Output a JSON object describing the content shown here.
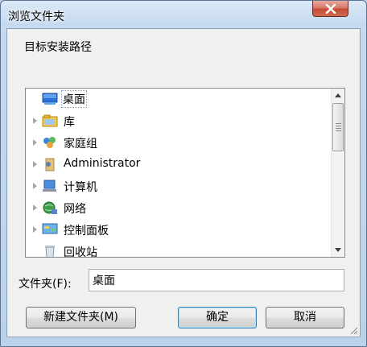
{
  "window": {
    "title": "浏览文件夹",
    "close_icon": "close-icon"
  },
  "instruction": "目标安装路径",
  "tree": {
    "items": [
      {
        "label": "桌面",
        "icon": "desktop-icon",
        "selected": true
      },
      {
        "label": "库",
        "icon": "libraries-icon"
      },
      {
        "label": "家庭组",
        "icon": "homegroup-icon"
      },
      {
        "label": "Administrator",
        "icon": "user-folder-icon"
      },
      {
        "label": "计算机",
        "icon": "computer-icon"
      },
      {
        "label": "网络",
        "icon": "network-icon"
      },
      {
        "label": "控制面板",
        "icon": "control-panel-icon"
      },
      {
        "label": "回收站",
        "icon": "recycle-bin-icon"
      }
    ]
  },
  "folder": {
    "label": "文件夹(F):",
    "value": "桌面"
  },
  "buttons": {
    "new_folder": "新建文件夹(M)",
    "ok": "确定",
    "cancel": "取消"
  }
}
